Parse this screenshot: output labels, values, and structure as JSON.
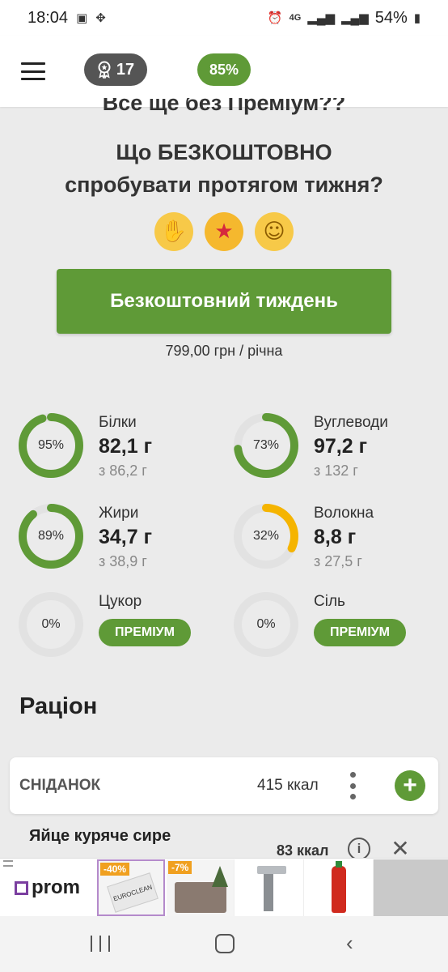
{
  "status_bar": {
    "time": "18:04",
    "network": "4G",
    "battery": "54%"
  },
  "app_bar": {
    "award_count": "17",
    "percent": "85%"
  },
  "promo": {
    "title_partial": "Все ще без Преміум??",
    "title_line1": "Що БЕЗКОШТОВНО",
    "title_line2": "спробувати протягом тижня?",
    "emojis": [
      "clapping-hands",
      "star-struck",
      "hugging-face"
    ],
    "button_label": "Безкоштовний тиждень",
    "price": "799,00 грн / річна"
  },
  "nutrients": [
    {
      "name": "Білки",
      "percent_label": "95%",
      "percent": 95,
      "value": "82,1 г",
      "of": "з 86,2 г",
      "color": "#5f9a37",
      "premium": false
    },
    {
      "name": "Вуглеводи",
      "percent_label": "73%",
      "percent": 73,
      "value": "97,2 г",
      "of": "з 132 г",
      "color": "#5f9a37",
      "premium": false
    },
    {
      "name": "Жири",
      "percent_label": "89%",
      "percent": 89,
      "value": "34,7 г",
      "of": "з 38,9 г",
      "color": "#5f9a37",
      "premium": false
    },
    {
      "name": "Волокна",
      "percent_label": "32%",
      "percent": 32,
      "value": "8,8 г",
      "of": "з 27,5 г",
      "color": "#f5b400",
      "premium": false
    },
    {
      "name": "Цукор",
      "percent_label": "0%",
      "percent": 0,
      "premium": true,
      "premium_label": "ПРЕМІУМ"
    },
    {
      "name": "Сіль",
      "percent_label": "0%",
      "percent": 0,
      "premium": true,
      "premium_label": "ПРЕМІУМ"
    }
  ],
  "diet": {
    "title": "Раціон",
    "meal": {
      "name": "СНІДАНОК",
      "kcal": "415 ккал"
    },
    "food": {
      "name": "Яйце куряче сире",
      "kcal": "83 ккал"
    }
  },
  "ad": {
    "logo": "prom",
    "items": [
      {
        "discount": "-40%",
        "name": "EUROCLEAN"
      },
      {
        "discount": "-7%"
      },
      {
        "discount": ""
      },
      {
        "discount": ""
      }
    ]
  },
  "colors": {
    "accent": "#5f9a37",
    "warning": "#f5b400",
    "track": "#e2e2e2"
  }
}
